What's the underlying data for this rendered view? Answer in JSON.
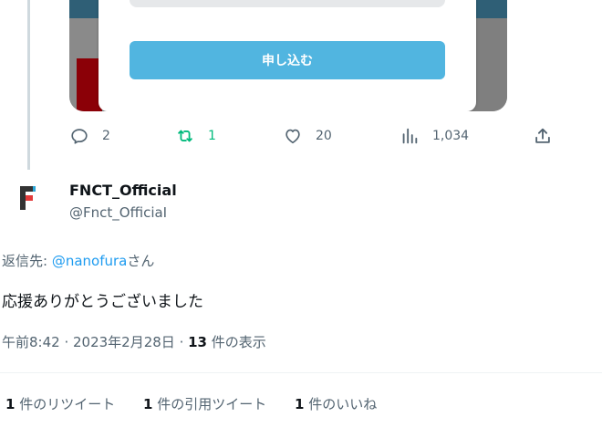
{
  "media": {
    "button_label": "申し込む",
    "colors": {
      "button": "#51b5e0",
      "band": "#2f5f76",
      "red_block": "#8b0007"
    }
  },
  "actions": {
    "reply": {
      "icon": "reply-icon",
      "count": "2"
    },
    "retweet": {
      "icon": "retweet-icon",
      "count": "1",
      "color": "#00ba7c"
    },
    "like": {
      "icon": "heart-icon",
      "count": "20"
    },
    "views": {
      "icon": "analytics-icon",
      "count": "1,034"
    },
    "share": {
      "icon": "share-icon"
    }
  },
  "author": {
    "display_name": "FNCT_Official",
    "handle": "@Fnct_OfficiaI",
    "avatar_colors": {
      "dark": "#333333",
      "accent": "#e33b3b",
      "blue": "#2aa7d9"
    }
  },
  "tweet": {
    "reply_prefix": "返信先: ",
    "reply_mention": "@nanofura",
    "reply_suffix": "さん",
    "text": "応援ありがとうございました",
    "time": "午前8:42",
    "sep": " · ",
    "date": "2023年2月28日",
    "views_count": "13",
    "views_label": " 件の表示"
  },
  "stats": {
    "retweets": {
      "count": "1",
      "label": " 件のリツイート"
    },
    "quotes": {
      "count": "1",
      "label": " 件の引用ツイート"
    },
    "likes": {
      "count": "1",
      "label": " 件のいいね"
    }
  }
}
